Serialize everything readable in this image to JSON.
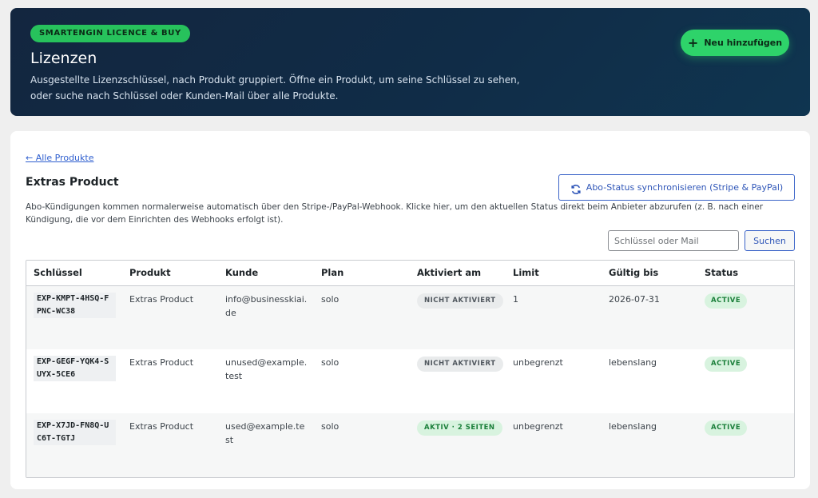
{
  "header": {
    "badge": "SMARTENGIN LICENCE & BUY",
    "title": "Lizenzen",
    "description": "Ausgestellte Lizenzschlüssel, nach Produkt gruppiert. Öffne ein Produkt, um seine Schlüssel zu sehen, oder suche nach Schlüssel oder Kunden-Mail über alle Produkte.",
    "new_button": "Neu hinzufügen"
  },
  "panel": {
    "back_link": "← Alle Produkte",
    "title": "Extras Product",
    "sync_button": "Abo-Status synchronisieren (Stripe & PayPal)",
    "description": "Abo-Kündigungen kommen normalerweise automatisch über den Stripe-/PayPal-Webhook. Klicke hier, um den aktuellen Status direkt beim Anbieter abzurufen (z. B. nach einer Kündigung, die vor dem Einrichten des Webhooks erfolgt ist).",
    "search_placeholder": "Schlüssel oder Mail",
    "search_button": "Suchen"
  },
  "table": {
    "headers": [
      "Schlüssel",
      "Produkt",
      "Kunde",
      "Plan",
      "Aktiviert am",
      "Limit",
      "Gültig bis",
      "Status"
    ],
    "rows": [
      {
        "key": "EXP-KMPT-4HSQ-FPNC-WC38",
        "product": "Extras Product",
        "customer": "info@businesskiai.de",
        "plan": "solo",
        "activated": "NICHT AKTIVIERT",
        "limit": "1",
        "valid_until": "2026-07-31",
        "status": "ACTIVE"
      },
      {
        "key": "EXP-GEGF-YQK4-SUYX-5CE6",
        "product": "Extras Product",
        "customer": "unused@example.test",
        "plan": "solo",
        "activated": "NICHT AKTIVIERT",
        "limit": "unbegrenzt",
        "valid_until": "lebenslang",
        "status": "ACTIVE"
      },
      {
        "key": "EXP-X7JD-FN8Q-UC6T-TGTJ",
        "product": "Extras Product",
        "customer": "used@example.test",
        "plan": "solo",
        "activated": "AKTIV · 2 SEITEN",
        "limit": "unbegrenzt",
        "valid_until": "lebenslang",
        "status": "ACTIVE"
      }
    ]
  },
  "colors": {
    "accent_green": "#2ed36a",
    "link_blue": "#2f5fcf",
    "header_bg": "#13263f"
  }
}
